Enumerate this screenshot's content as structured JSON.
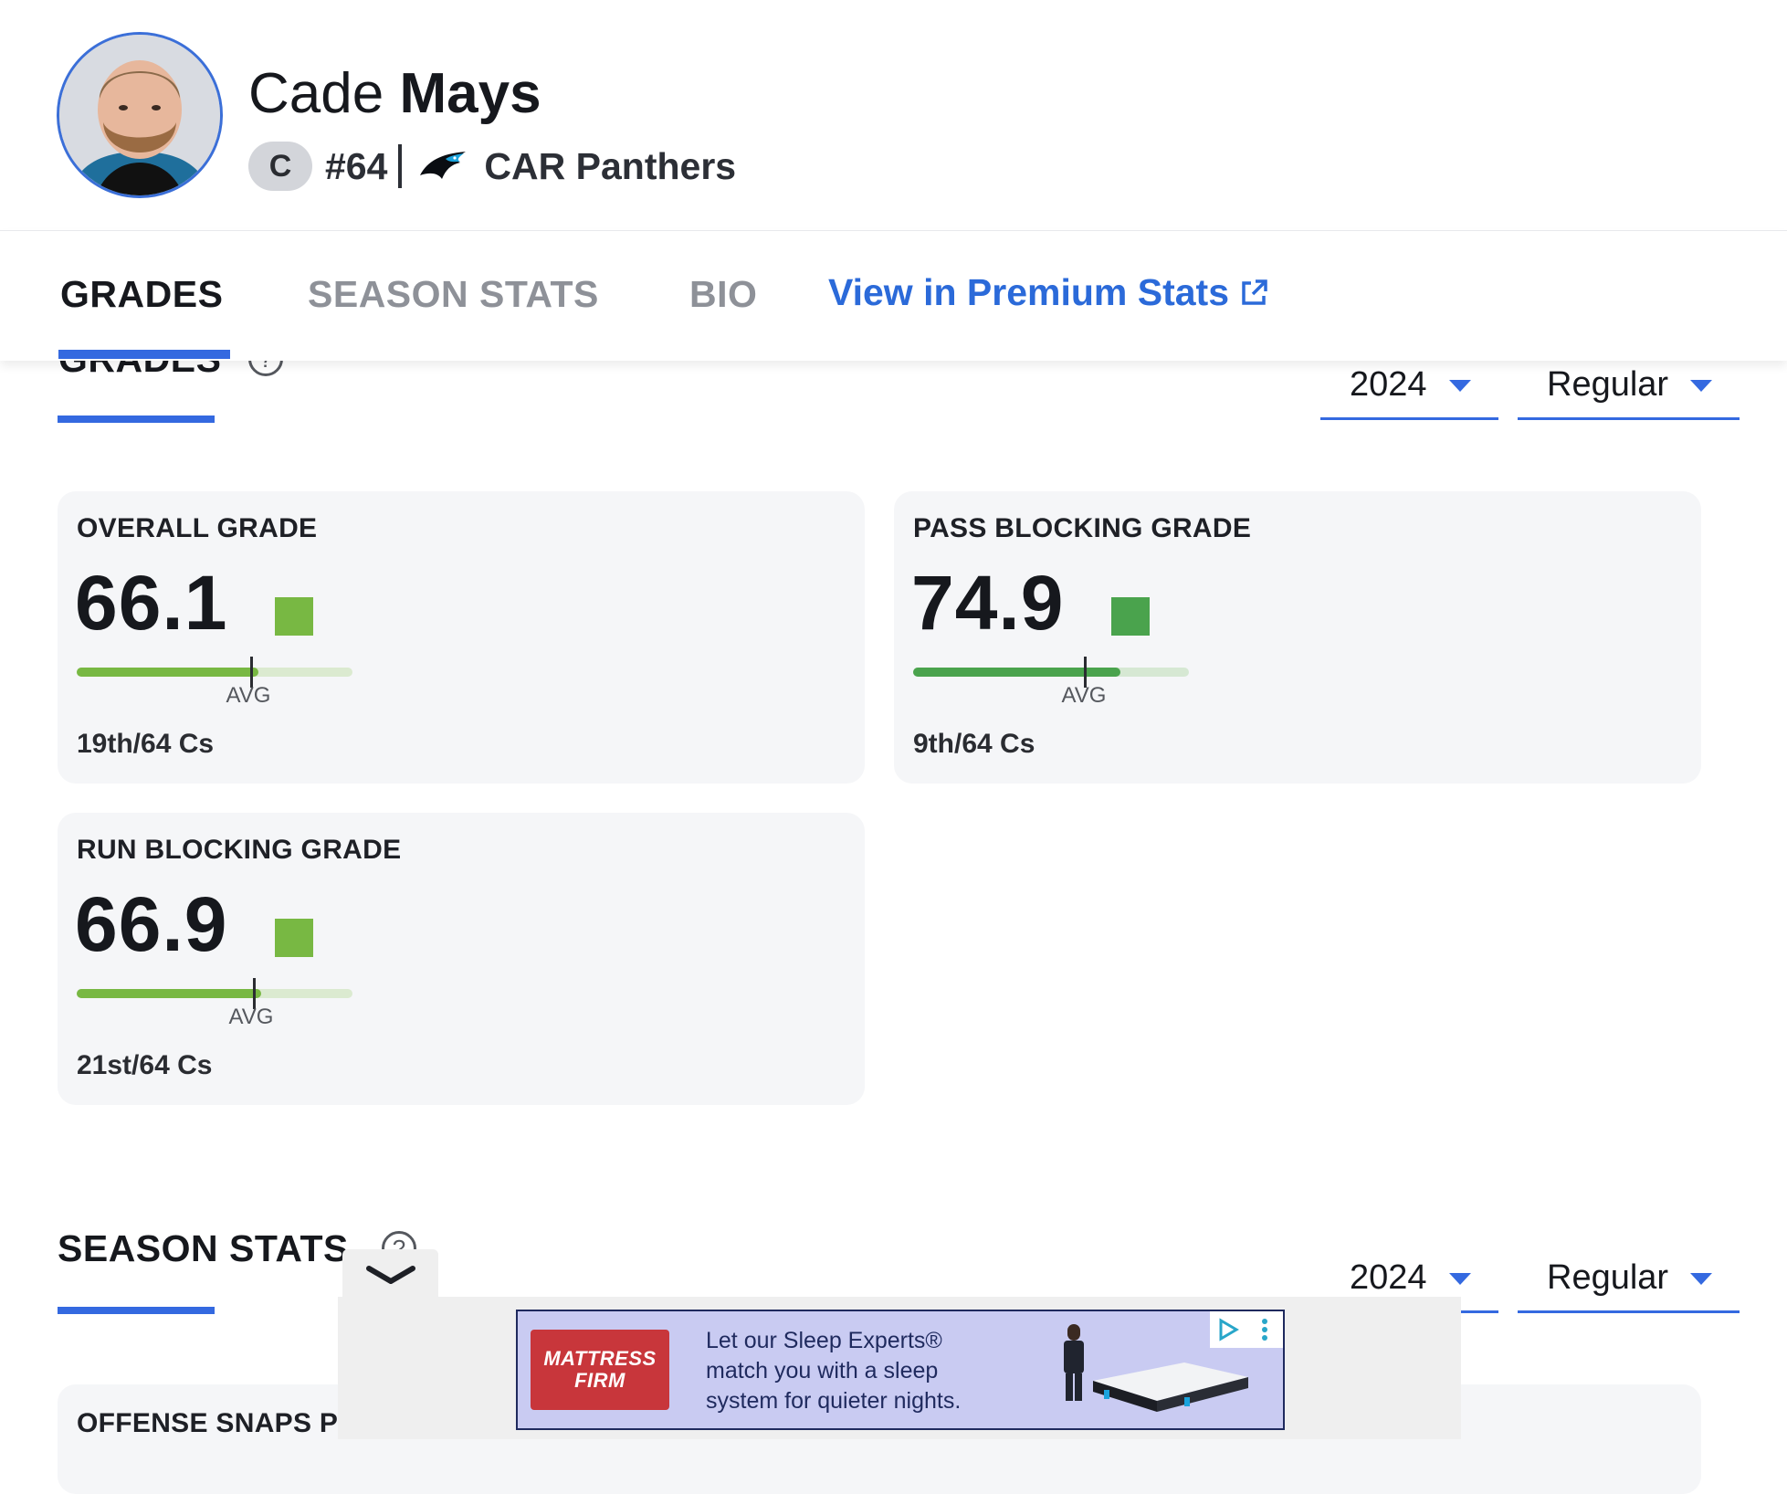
{
  "player": {
    "first_name": "Cade",
    "last_name": "Mays",
    "position": "C",
    "number": "#64",
    "team": "CAR Panthers"
  },
  "tabs": {
    "grades": "GRADES",
    "season_stats": "SEASON STATS",
    "bio": "BIO",
    "premium": "View in Premium Stats"
  },
  "grades_section": {
    "title": "GRADES",
    "help": "?",
    "year": "2024",
    "season_type": "Regular"
  },
  "grade_cards": [
    {
      "label": "OVERALL GRADE",
      "value": "66.1",
      "fill_pct": 66,
      "avg_pct": 63,
      "avg_label": "AVG",
      "rank": "19th/64 Cs",
      "color": "#78b843"
    },
    {
      "label": "PASS BLOCKING GRADE",
      "value": "74.9",
      "fill_pct": 75,
      "avg_pct": 62,
      "avg_label": "AVG",
      "rank": "9th/64 Cs",
      "color": "#4aa34d"
    },
    {
      "label": "RUN BLOCKING GRADE",
      "value": "66.9",
      "fill_pct": 67,
      "avg_pct": 64,
      "avg_label": "AVG",
      "rank": "21st/64 Cs",
      "color": "#78b843"
    }
  ],
  "season_section": {
    "title": "SEASON STATS",
    "help": "?",
    "year": "2024",
    "season_type": "Regular",
    "first_card_label": "OFFENSE SNAPS P"
  },
  "ad": {
    "brand_line1": "MATTRESS",
    "brand_line2": "FIRM",
    "line1": "Let our Sleep Experts®",
    "line2": "match you with a sleep",
    "line3": "system for quieter nights."
  },
  "colors": {
    "accent": "#3469e0",
    "link": "#2b6ad9",
    "grade_good": "#78b843",
    "grade_great": "#4aa34d"
  }
}
